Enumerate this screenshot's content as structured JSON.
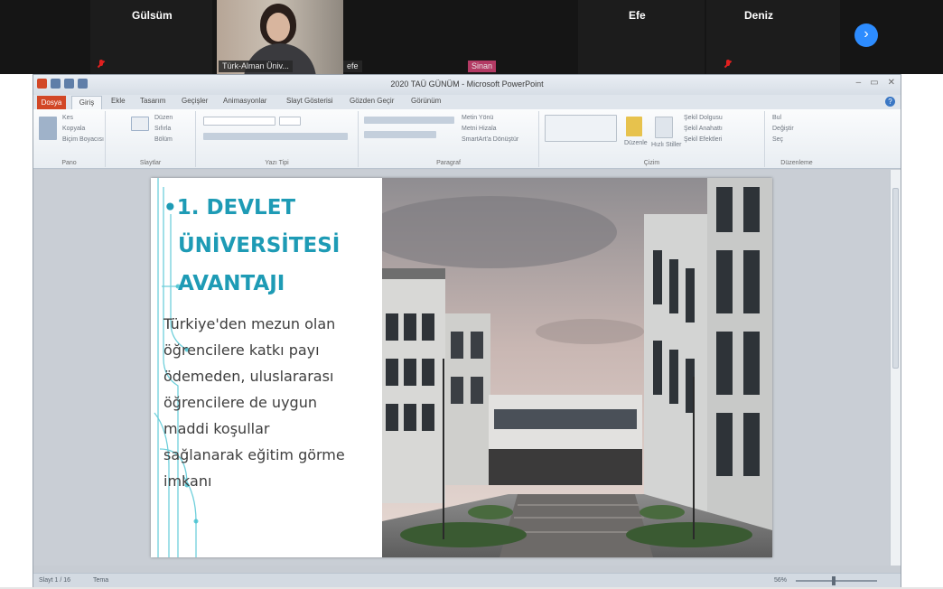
{
  "meeting": {
    "participants": [
      {
        "name": "Gülsüm"
      },
      {
        "name": "Efe"
      },
      {
        "name": "Deniz"
      }
    ],
    "video_tile": {
      "label": "Türk-Alman Üniv..."
    },
    "tags": [
      "efe",
      "Sinan"
    ],
    "next_icon": "chevron-right-icon"
  },
  "powerpoint": {
    "window_title": "2020 TAÜ GÜNÜM - Microsoft PowerPoint",
    "window_controls": [
      "–",
      "▭",
      "✕"
    ],
    "tabs": {
      "file": "Dosya",
      "home": "Giriş",
      "others": [
        "Ekle",
        "Tasarım",
        "Geçişler",
        "Animasyonlar",
        "Slayt Gösterisi",
        "Gözden Geçir",
        "Görünüm"
      ]
    },
    "ribbon": {
      "groups": [
        "Pano",
        "Slaytlar",
        "Yazı Tipi",
        "Paragraf",
        "Çizim",
        "Düzenleme"
      ],
      "clipboard": [
        "Kes",
        "Kopyala",
        "Biçim Boyacısı"
      ],
      "slides": [
        "Düzen",
        "Sıfırla",
        "Bölüm"
      ],
      "paragraph": [
        "Metin Yönü",
        "Metni Hizala",
        "SmartArt'a Dönüştür"
      ],
      "drawing": [
        "Şekil Dolgusu",
        "Şekil Anahattı",
        "Şekil Efektleri",
        "Düzenle",
        "Hızlı Stiller"
      ],
      "editing": [
        "Bul",
        "Değiştir",
        "Seç"
      ]
    },
    "statusbar": {
      "slide_info": "Slayt 1 / 16",
      "theme": "Tema",
      "zoom": "56%"
    }
  },
  "slide": {
    "title_lines": [
      "•1. DEVLET",
      "ÜNİVERSİTESİ",
      "AVANTAJI"
    ],
    "body_lines": [
      "Türkiye'den mezun olan",
      "öğrencilere katkı payı",
      "ödemeden, uluslararası",
      "öğrencilere de uygun",
      "maddi koşullar",
      "sağlanarak eğitim görme",
      "imkanı"
    ],
    "colors": {
      "title": "#1e9bb5",
      "body": "#3e3e3e",
      "accent": "#2d8cff",
      "file_tab": "#d24726"
    }
  }
}
